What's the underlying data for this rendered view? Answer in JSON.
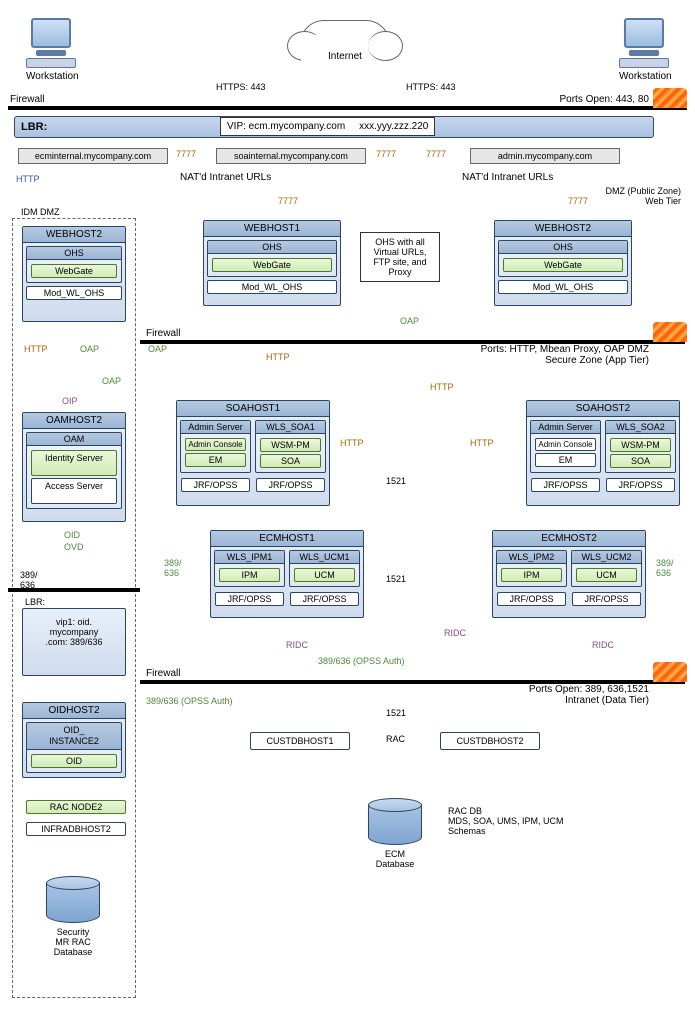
{
  "top": {
    "workstation_label": "Workstation",
    "internet_label": "Internet",
    "https_label": "HTTPS: 443"
  },
  "firewall1": {
    "label": "Firewall",
    "ports": "Ports Open: 443, 80"
  },
  "lbr": {
    "title": "LBR:",
    "vip": "VIP: ecm.mycompany.com",
    "vip_ip": "xxx.yyy.zzz.220"
  },
  "nat": {
    "ecm": "ecminternal.mycompany.com",
    "soa": "soainternal.mycompany.com",
    "admin": "admin.mycompany.com",
    "port": "7777",
    "natd_label": "NAT'd Intranet URLs"
  },
  "dmz_sub": "DMZ (Public Zone)\nWeb Tier",
  "idm": {
    "title": "IDM DMZ",
    "webhost2": "WEBHOST2",
    "ohs": "OHS",
    "webgate": "WebGate",
    "mod": "Mod_WL_OHS",
    "oamhost2": "OAMHOST2",
    "oam": "OAM",
    "identity_server": "Identity Server",
    "access_server": "Access Server",
    "lbr2": "LBR:",
    "lbr2_label": "vip1: oid.\nmycompany\n.com: 389/636",
    "oidhost2": "OIDHOST2",
    "oid_instance2": "OID_\nINSTANCE2",
    "oid": "OID",
    "rac_node2": "RAC NODE2",
    "infradbhost2": "INFRADBHOST2",
    "security_db": "Security\nMR RAC\nDatabase"
  },
  "webhosts": {
    "webhost1": "WEBHOST1",
    "webhost2": "WEBHOST2",
    "ohs": "OHS",
    "webgate": "WebGate",
    "mod": "Mod_WL_OHS",
    "ohs_desc": "OHS with all\nVirtual URLs,\nFTP site, and\nProxy"
  },
  "firewall2": {
    "label": "Firewall",
    "ports": "Ports: HTTP, Mbean Proxy, OAP DMZ\nSecure Zone (App Tier)"
  },
  "soahosts": {
    "soahost1": "SOAHOST1",
    "soahost2": "SOAHOST2",
    "admin_server": "Admin Server",
    "admin_console": "Admin Console",
    "em": "EM",
    "wls_soa1": "WLS_SOA1",
    "wls_soa2": "WLS_SOA2",
    "wsm_pm": "WSM-PM",
    "soa": "SOA",
    "jrf_opss": "JRF/OPSS"
  },
  "ecmhosts": {
    "ecmhost1": "ECMHOST1",
    "ecmhost2": "ECMHOST2",
    "wls_ipm1": "WLS_IPM1",
    "wls_ipm2": "WLS_IPM2",
    "wls_ucm1": "WLS_UCM1",
    "wls_ucm2": "WLS_UCM2",
    "ipm": "IPM",
    "ucm": "UCM",
    "jrf_opss": "JRF/OPSS"
  },
  "firewall3": {
    "label": "Firewall",
    "ports": "Ports Open: 389, 636,1521\nIntranet (Data Tier)"
  },
  "db": {
    "custdbhost1": "CUSTDBHOST1",
    "custdbhost2": "CUSTDBHOST2",
    "rac": "RAC",
    "ecm_db": "ECM\nDatabase",
    "rac_db_desc": "RAC DB\nMDS, SOA, UMS, IPM, UCM\nSchemas"
  },
  "conn": {
    "http": "HTTP",
    "https": "HTTPS",
    "oap": "OAP",
    "oip": "OIP",
    "oid": "OID",
    "ovd": "OVD",
    "ridc": "RIDC",
    "port_1521": "1521",
    "port_389_636": "389/\n636",
    "port_389_636_line": "389/636",
    "opss_auth": "389/636 (OPSS Auth)"
  }
}
